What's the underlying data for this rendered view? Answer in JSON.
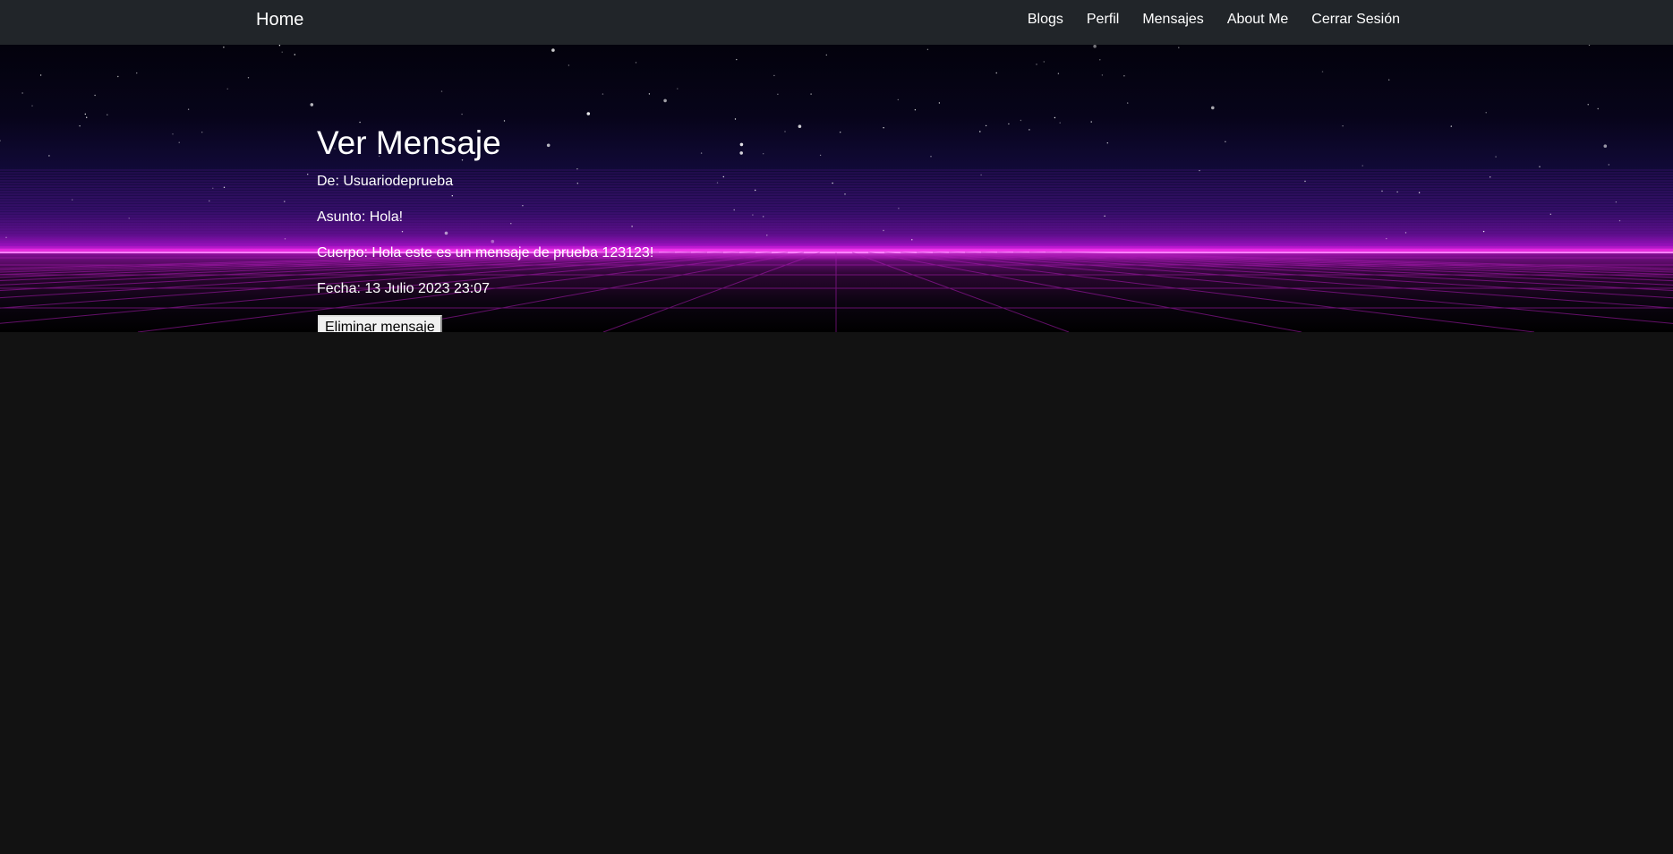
{
  "navbar": {
    "brand": "Home",
    "links": [
      "Blogs",
      "Perfil",
      "Mensajes",
      "About Me",
      "Cerrar Sesión"
    ]
  },
  "message": {
    "heading": "Ver Mensaje",
    "from": "De: Usuariodeprueba",
    "subject": "Asunto: Hola!",
    "body": "Cuerpo: Hola este es un mensaje de prueba 123123!",
    "date": "Fecha: 13 Julio 2023 23:07",
    "delete_label": "Eliminar mensaje"
  },
  "colors": {
    "navbar_bg": "#212529",
    "page_bg": "#121212",
    "horizon_glow": "#f22ee6"
  }
}
